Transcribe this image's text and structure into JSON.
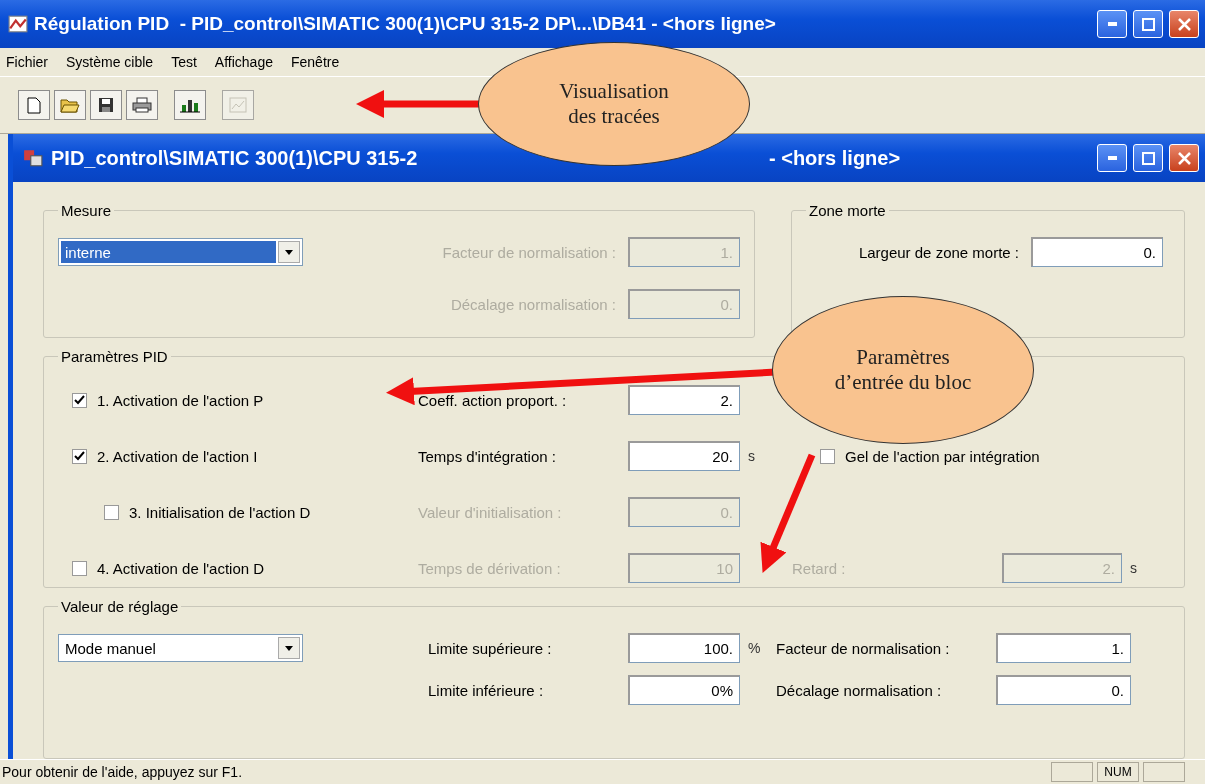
{
  "window": {
    "title": "Régulation PID  - PID_control\\SIMATIC 300(1)\\CPU 315-2 DP\\...\\DB41 - <hors ligne>"
  },
  "menu": [
    "Fichier",
    "Système cible",
    "Test",
    "Affichage",
    "Fenêtre"
  ],
  "toolbar": [
    {
      "kind": "new",
      "disabled": false
    },
    {
      "kind": "open",
      "disabled": false
    },
    {
      "kind": "save",
      "disabled": false
    },
    {
      "kind": "print",
      "disabled": false
    },
    {
      "kind": "bars",
      "disabled": false
    },
    {
      "kind": "trend",
      "disabled": true
    }
  ],
  "dialog": {
    "title_start": "PID_control\\SIMATIC 300(1)\\CPU 315-2",
    "title_end": "- <hors ligne>",
    "mesure": {
      "title": "Mesure",
      "select": {
        "value": "interne",
        "highlighted": true
      },
      "fields": [
        {
          "label": "Facteur de normalisation :",
          "value": "1.",
          "disabled": true
        },
        {
          "label": "Décalage normalisation :",
          "value": "0.",
          "disabled": true
        }
      ]
    },
    "zone_morte": {
      "title": "Zone morte",
      "field": {
        "label": "Largeur de zone morte :",
        "value": "0.",
        "disabled": false
      }
    },
    "pid": {
      "title": "Paramètres PID",
      "rows": [
        {
          "check": {
            "label": "1. Activation de l'action P",
            "checked": true,
            "indented": false
          },
          "field": {
            "label": "Coeff. action proport. :",
            "value": "2.",
            "disabled": false
          }
        },
        {
          "check": {
            "label": "2. Activation de l'action I",
            "checked": true,
            "indented": false
          },
          "field": {
            "label": "Temps d'intégration :",
            "value": "20.",
            "unit": "s",
            "disabled": false
          },
          "extra": {
            "kind": "checkbox",
            "label": "Gel de l'action par intégration",
            "checked": false
          }
        },
        {
          "check": {
            "label": "3. Initialisation de l'action D",
            "checked": false,
            "indented": true
          },
          "field": {
            "label": "Valeur d'initialisation :",
            "value": "0.",
            "disabled": true
          }
        },
        {
          "check": {
            "label": "4. Activation de l'action D",
            "checked": false,
            "indented": false
          },
          "field": {
            "label": "Temps de dérivation :",
            "value": "10",
            "disabled": true
          },
          "extra": {
            "kind": "field",
            "label": "Retard :",
            "value": "2.",
            "unit": "s",
            "disabled": true
          }
        }
      ]
    },
    "reglage": {
      "title": "Valeur de réglage",
      "select": {
        "value": "Mode manuel",
        "highlighted": false
      },
      "fields": [
        {
          "label": "Limite supérieure :",
          "value": "100.",
          "unit": "%",
          "disabled": false
        },
        {
          "label": "Facteur de normalisation :",
          "value": "1.",
          "disabled": false
        },
        {
          "label": "Limite inférieure :",
          "value": "0%",
          "disabled": false
        },
        {
          "label": "Décalage normalisation :",
          "value": "0.",
          "disabled": false
        }
      ]
    }
  },
  "status_bar": {
    "text": "Pour obtenir de l'aide, appuyez sur F1.",
    "indicators": [
      "NUM"
    ]
  },
  "callouts": [
    {
      "text": "Visualisation des tracées"
    },
    {
      "text": "Paramètres d’entrée du bloc"
    }
  ]
}
